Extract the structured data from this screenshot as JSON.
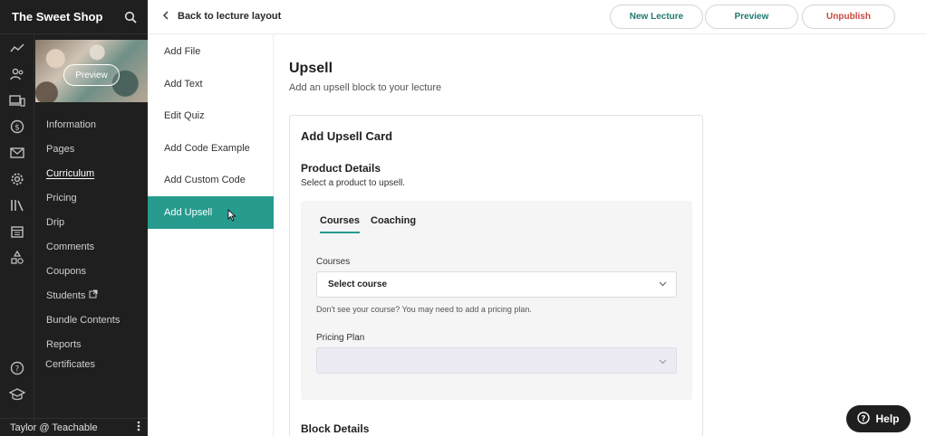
{
  "school": {
    "name": "The Sweet Shop"
  },
  "thumbnail": {
    "preview_label": "Preview"
  },
  "sidebar": {
    "items": [
      {
        "label": "Information",
        "active": false
      },
      {
        "label": "Pages",
        "active": false
      },
      {
        "label": "Curriculum",
        "active": true
      },
      {
        "label": "Pricing",
        "active": false
      },
      {
        "label": "Drip",
        "active": false
      },
      {
        "label": "Comments",
        "active": false
      },
      {
        "label": "Coupons",
        "active": false
      },
      {
        "label": "Students",
        "active": false
      },
      {
        "label": "Bundle Contents",
        "active": false
      },
      {
        "label": "Reports",
        "active": false
      }
    ],
    "certificates": "Certificates",
    "rail_icons": [
      "analytics-icon",
      "users-icon",
      "devices-icon",
      "dollar-icon",
      "mail-icon",
      "gear-icon",
      "library-icon",
      "calendar-icon",
      "shapes-icon",
      "help-circle-icon",
      "graduation-cap-icon"
    ]
  },
  "user": {
    "label": "Taylor @ Teachable"
  },
  "topbar": {
    "back_label": "Back to lecture layout",
    "new_lecture": "New Lecture",
    "preview": "Preview",
    "unpublish": "Unpublish"
  },
  "content_types": [
    "Add File",
    "Add Text",
    "Edit Quiz",
    "Add Code Example",
    "Add Custom Code",
    "Add Upsell"
  ],
  "main": {
    "title": "Upsell",
    "subtitle": "Add an upsell block to your lecture",
    "card": {
      "title": "Add Upsell Card",
      "product_details_title": "Product Details",
      "product_details_sub": "Select a product to upsell.",
      "tabs": [
        "Courses",
        "Coaching"
      ],
      "courses_label": "Courses",
      "courses_value": "Select course",
      "help_text": "Don't see your course? You may need to add a pricing plan.",
      "plan_label": "Pricing Plan",
      "plan_value": "",
      "block_details_title": "Block Details"
    }
  },
  "help_button": {
    "label": "Help"
  },
  "colors": {
    "accent": "#269b8e",
    "sidebar_bg": "#1f1f1f",
    "danger": "#c94a3e"
  }
}
